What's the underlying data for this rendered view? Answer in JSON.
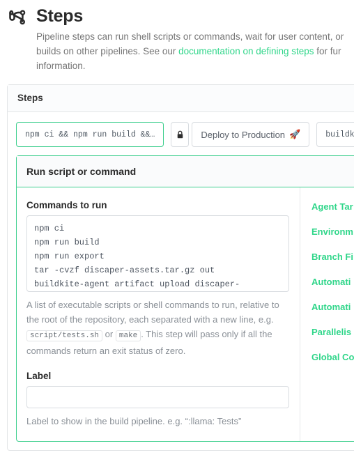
{
  "header": {
    "icon": "pipeline-icon",
    "title": "Steps",
    "description_part1": "Pipeline steps can run shell scripts or commands, wait for user content, or ",
    "description_part2": "builds on other pipelines. See our ",
    "link_text": "documentation on defining steps",
    "description_part3": " for fur",
    "description_part4": "information.",
    "link_color": "#30d68a"
  },
  "steps_card": {
    "title": "Steps",
    "chips": [
      {
        "label": "npm ci && npm run build &&…",
        "style": "mono",
        "selected": true,
        "lock": false,
        "emoji": ""
      },
      {
        "label": "Deploy to Production",
        "style": "text",
        "selected": false,
        "lock": true,
        "lock_icon": "lock-icon",
        "emoji": "🚀"
      },
      {
        "label": "buildki",
        "style": "mono",
        "selected": false,
        "lock": false,
        "emoji": ""
      }
    ]
  },
  "editor": {
    "title": "Run script or command",
    "commands_label": "Commands to run",
    "commands_value": "npm ci\nnpm run build\nnpm run export\ntar -cvzf discaper-assets.tar.gz out\nbuildkite-agent artifact upload discaper-assets.tar.gz",
    "commands_help_1": "A list of executable scripts or shell commands to run, relative to the root of the repository, each separated with a new line, e.g.",
    "commands_help_code_1": "script/tests.sh",
    "commands_help_or": "or",
    "commands_help_code_2": "make",
    "commands_help_2": ". This step will pass only if all the commands return an exit status of zero.",
    "label_label": "Label",
    "label_value": "",
    "label_placeholder": "",
    "label_help": "Label to show in the build pipeline. e.g. “:llama: Tests”",
    "side_links": [
      "Agent Tar",
      "Environm",
      "Branch Fi",
      "Automati",
      "Automati",
      "Parallelis",
      "Global Co"
    ],
    "accent_color": "#3ecf8e"
  }
}
